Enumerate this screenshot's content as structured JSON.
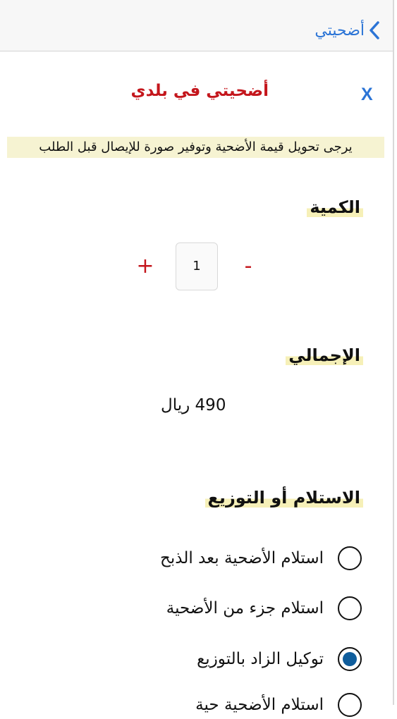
{
  "navbar": {
    "back_label": "أضحيتي"
  },
  "modal": {
    "title": "أضحيتي في بلدي",
    "close_label": "X",
    "notice": "يرجى تحويل قيمة الأضحية وتوفير صورة للإيصال قبل الطلب"
  },
  "quantity": {
    "label": "الكمية",
    "plus": "+",
    "value": "1",
    "minus": "-"
  },
  "total": {
    "label": "الإجمالي",
    "amount": "490 ريال"
  },
  "delivery": {
    "label": "الاستلام أو التوزيع",
    "options": [
      {
        "label": "استلام الأضحية بعد الذبح",
        "selected": false
      },
      {
        "label": "استلام جزء من  الأضحية",
        "selected": false
      },
      {
        "label": "توكيل الزاد بالتوزيع",
        "selected": true
      },
      {
        "label": "استلام الأضحية حية",
        "selected": false
      }
    ]
  },
  "colors": {
    "accent_blue": "#2b74d6",
    "title_red": "#c4161c",
    "radio_fill": "#0f5d9c",
    "highlight": "#f6f0b8"
  },
  "icons": {
    "back": "chevron-left-icon"
  }
}
